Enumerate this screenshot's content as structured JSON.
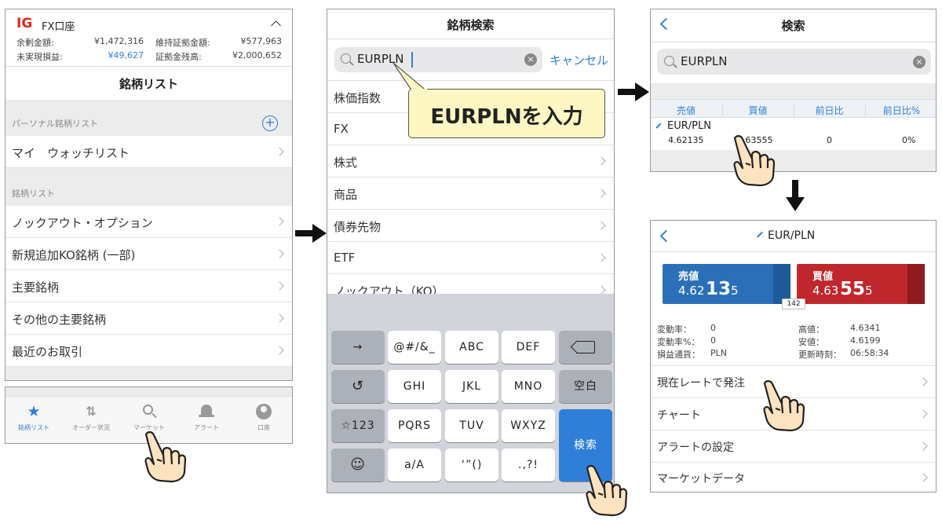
{
  "p1": {
    "logo": "IG",
    "account": "FX口座",
    "stats": [
      {
        "label": "余剰金額:",
        "value": "¥1,472,316"
      },
      {
        "label": "維持証拠金額:",
        "value": "¥577,963"
      },
      {
        "label": "未実現損益:",
        "value": "¥49,627"
      },
      {
        "label": "証拠金残高:",
        "value": "¥2,000,652"
      }
    ],
    "title": "銘柄リスト",
    "personal_header": "パーソナル銘柄リスト",
    "watchlist": "マイ　ウォッチリスト",
    "list_header": "銘柄リスト",
    "items": [
      "ノックアウト・オプション",
      "新規追加KO銘柄 (一部)",
      "主要銘柄",
      "その他の主要銘柄",
      "最近のお取引"
    ]
  },
  "tabs": [
    "銘柄リスト",
    "オーダー状況",
    "マーケット",
    "アラート",
    "口座"
  ],
  "p2": {
    "title": "銘柄検索",
    "search_value": "EURPLN",
    "cancel": "キャンセル",
    "callout": "EURPLNを入力",
    "items": [
      "株価指数",
      "FX",
      "株式",
      "商品",
      "債券先物",
      "ETF",
      "ノックアウト（KO）"
    ]
  },
  "keyboard": {
    "r1": [
      "→",
      "@#/&_",
      "ABC",
      "DEF"
    ],
    "r2": [
      "GHI",
      "JKL",
      "MNO",
      "空白"
    ],
    "r3": [
      "☆123",
      "PQRS",
      "TUV",
      "WXYZ"
    ],
    "r4": [
      "a/A",
      "‘”()",
      ".,?!"
    ],
    "search": "検索"
  },
  "p3": {
    "title": "検索",
    "search_value": "EURPLN",
    "headers": [
      "売値",
      "買値",
      "前日比",
      "前日比%"
    ],
    "instrument": "EUR/PLN",
    "bid": "4.62135",
    "ask": "4.63555",
    "change": "0",
    "change_pct": "0%"
  },
  "p4": {
    "title": "EUR/PLN",
    "sell_label": "売値",
    "sell_pre": "4.62",
    "sell_big": "13",
    "sell_post": "5",
    "buy_label": "買値",
    "buy_pre": "4.63",
    "buy_big": "55",
    "buy_post": "5",
    "spread": "142",
    "stats_left": [
      {
        "label": "変動率：",
        "value": "0"
      },
      {
        "label": "変動率%：",
        "value": "0"
      },
      {
        "label": "損益通貨：",
        "value": "PLN"
      }
    ],
    "stats_right": [
      {
        "label": "高値：",
        "value": "4.6341"
      },
      {
        "label": "安値：",
        "value": "4.6199"
      },
      {
        "label": "更新時刻：",
        "value": "06:58:34"
      }
    ],
    "menu": [
      "現在レートで発注",
      "チャート",
      "アラートの設定",
      "マーケットデータ"
    ]
  },
  "colors": {
    "accent": "#2f7fd8",
    "sell": "#2a6fb8",
    "buy": "#c0272d",
    "ig": "#e1251b"
  }
}
